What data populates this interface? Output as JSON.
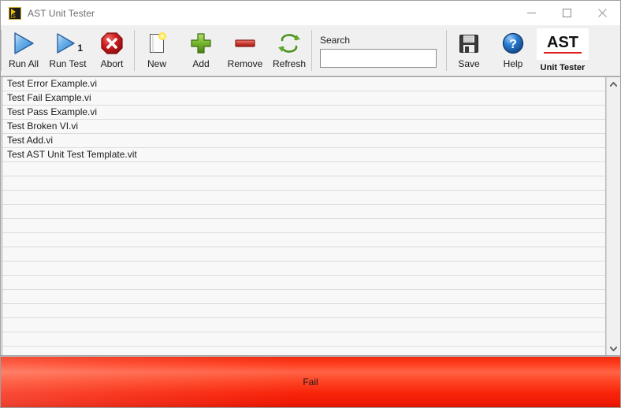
{
  "window": {
    "title": "AST Unit Tester",
    "icon": "labview-vi-icon",
    "controls": {
      "minimize": "minimize-icon",
      "maximize": "maximize-icon",
      "close": "close-icon"
    }
  },
  "toolbar": {
    "buttons": [
      {
        "label": "Run All",
        "icon": "run-all-icon",
        "badge": ""
      },
      {
        "label": "Run Test",
        "icon": "run-test-icon",
        "badge": "1"
      },
      {
        "label": "Abort",
        "icon": "abort-icon",
        "badge": ""
      },
      {
        "label": "New",
        "icon": "new-file-icon",
        "badge": ""
      },
      {
        "label": "Add",
        "icon": "add-plus-icon",
        "badge": ""
      },
      {
        "label": "Remove",
        "icon": "remove-minus-icon",
        "badge": ""
      },
      {
        "label": "Refresh",
        "icon": "refresh-icon",
        "badge": ""
      },
      {
        "label": "Save",
        "icon": "save-floppy-icon",
        "badge": ""
      },
      {
        "label": "Help",
        "icon": "help-question-icon",
        "badge": ""
      }
    ],
    "search": {
      "label": "Search",
      "value": "",
      "placeholder": ""
    },
    "brand": {
      "logo_text": "AST",
      "subtitle": "Unit Tester",
      "accent_color": "#e01b1b"
    }
  },
  "test_list": {
    "items": [
      {
        "name": "Test Error Example.vi"
      },
      {
        "name": "Test Fail Example.vi"
      },
      {
        "name": "Test Pass Example.vi"
      },
      {
        "name": "Test Broken VI.vi"
      },
      {
        "name": "Test Add.vi"
      },
      {
        "name": "Test AST Unit Test Template.vit"
      }
    ],
    "empty_row_count": 13,
    "scrollbar": {
      "up_arrow": "chevron-up-icon",
      "down_arrow": "chevron-down-icon"
    }
  },
  "status": {
    "text": "Fail",
    "color": "#ff2a0d"
  }
}
